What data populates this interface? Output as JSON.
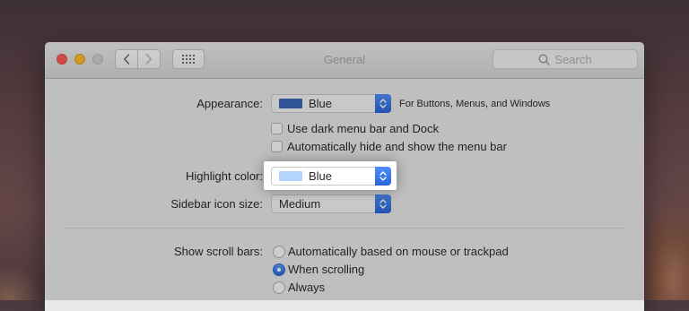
{
  "window": {
    "title": "General",
    "search_placeholder": "Search"
  },
  "icons": {
    "close": "close-button",
    "minimize": "minimize-button",
    "zoom": "zoom-button",
    "back": "chevron-left-icon",
    "forward": "chevron-right-icon",
    "grid": "grid-icon",
    "search": "search-icon",
    "stepper": "updown-chevron-icon"
  },
  "appearance": {
    "label": "Appearance:",
    "value": "Blue",
    "swatch_color": "#3a66b8",
    "note": "For Buttons, Menus, and Windows"
  },
  "checkboxes": [
    {
      "label": "Use dark menu bar and Dock",
      "checked": false
    },
    {
      "label": "Automatically hide and show the menu bar",
      "checked": false
    }
  ],
  "highlight": {
    "label": "Highlight color:",
    "value": "Blue",
    "swatch_color": "#b4d5fb"
  },
  "sidebar": {
    "label": "Sidebar icon size:",
    "value": "Medium"
  },
  "scrollbars": {
    "label": "Show scroll bars:",
    "options": [
      {
        "label": "Automatically based on mouse or trackpad",
        "selected": false
      },
      {
        "label": "When scrolling",
        "selected": true
      },
      {
        "label": "Always",
        "selected": false
      }
    ]
  },
  "colors": {
    "accent": "#2f6fe0",
    "traffic_close": "#fc5f57",
    "traffic_minimize": "#fdbc2e"
  }
}
